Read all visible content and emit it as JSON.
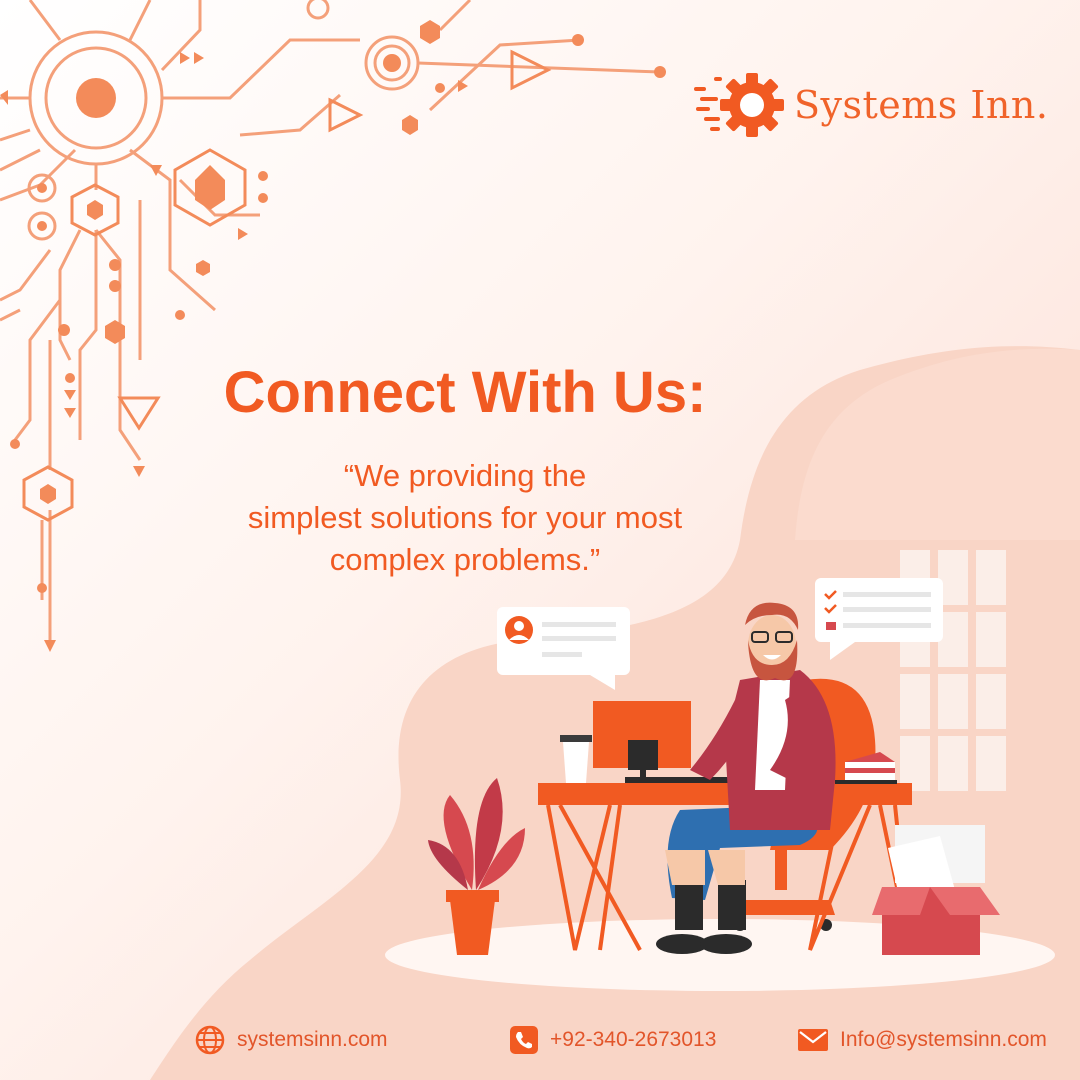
{
  "brand": {
    "name": "Systems Inn.",
    "accent_color": "#f15a22"
  },
  "headline": "Connect With Us:",
  "tagline": {
    "line1": "“We providing the",
    "line2": "simplest solutions for your most",
    "line3": "complex problems.”"
  },
  "contacts": {
    "website": {
      "icon": "globe-icon",
      "text": "systemsinn.com"
    },
    "phone": {
      "icon": "phone-icon",
      "text": "+92-340-2673013"
    },
    "email": {
      "icon": "envelope-icon",
      "text": "Info@systemsinn.com"
    }
  },
  "illustration": {
    "subject": "man working at computer desk",
    "icons": [
      "circuit-board-icon",
      "user-profile-card-icon",
      "checklist-card-icon",
      "coffee-cup-icon",
      "plant-icon",
      "box-icon"
    ]
  }
}
